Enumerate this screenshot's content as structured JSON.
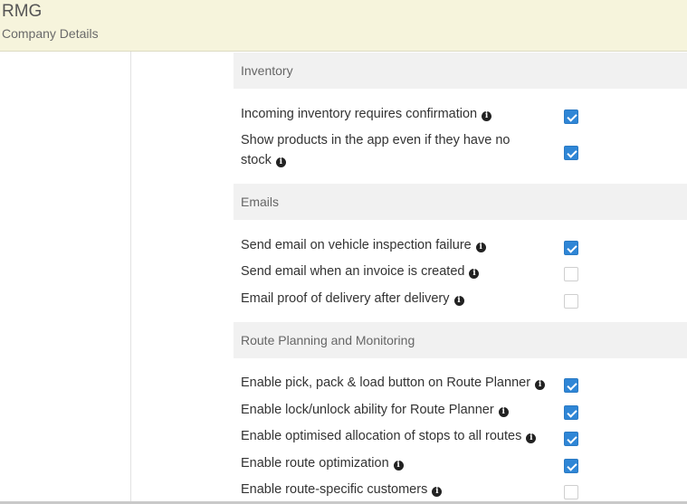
{
  "header": {
    "title": "RMG",
    "subtitle": "Company Details"
  },
  "sections": [
    {
      "title": "Inventory",
      "items": [
        {
          "label": "Incoming inventory requires confirmation",
          "checked": true
        },
        {
          "label_line1": "Show products in the app even if they have no",
          "label_line2": "stock",
          "checked": true
        }
      ]
    },
    {
      "title": "Emails",
      "items": [
        {
          "label": "Send email on vehicle inspection failure",
          "checked": true
        },
        {
          "label": "Send email when an invoice is created",
          "checked": false
        },
        {
          "label": "Email proof of delivery after delivery",
          "checked": false
        }
      ]
    },
    {
      "title": "Route Planning and Monitoring",
      "items": [
        {
          "label": "Enable pick, pack & load button on Route Planner",
          "checked": true
        },
        {
          "label": "Enable lock/unlock ability for Route Planner",
          "checked": true
        },
        {
          "label": "Enable optimised allocation of stops to all routes",
          "checked": true
        },
        {
          "label": "Enable route optimization",
          "checked": true
        },
        {
          "label": "Enable route-specific customers",
          "checked": false
        }
      ]
    }
  ],
  "colors": {
    "header_bg": "#f6f4dc",
    "section_bg": "#f1f1f1",
    "checkbox_accent": "#2f86d6"
  },
  "icons": {
    "info": "info-circle-icon"
  }
}
